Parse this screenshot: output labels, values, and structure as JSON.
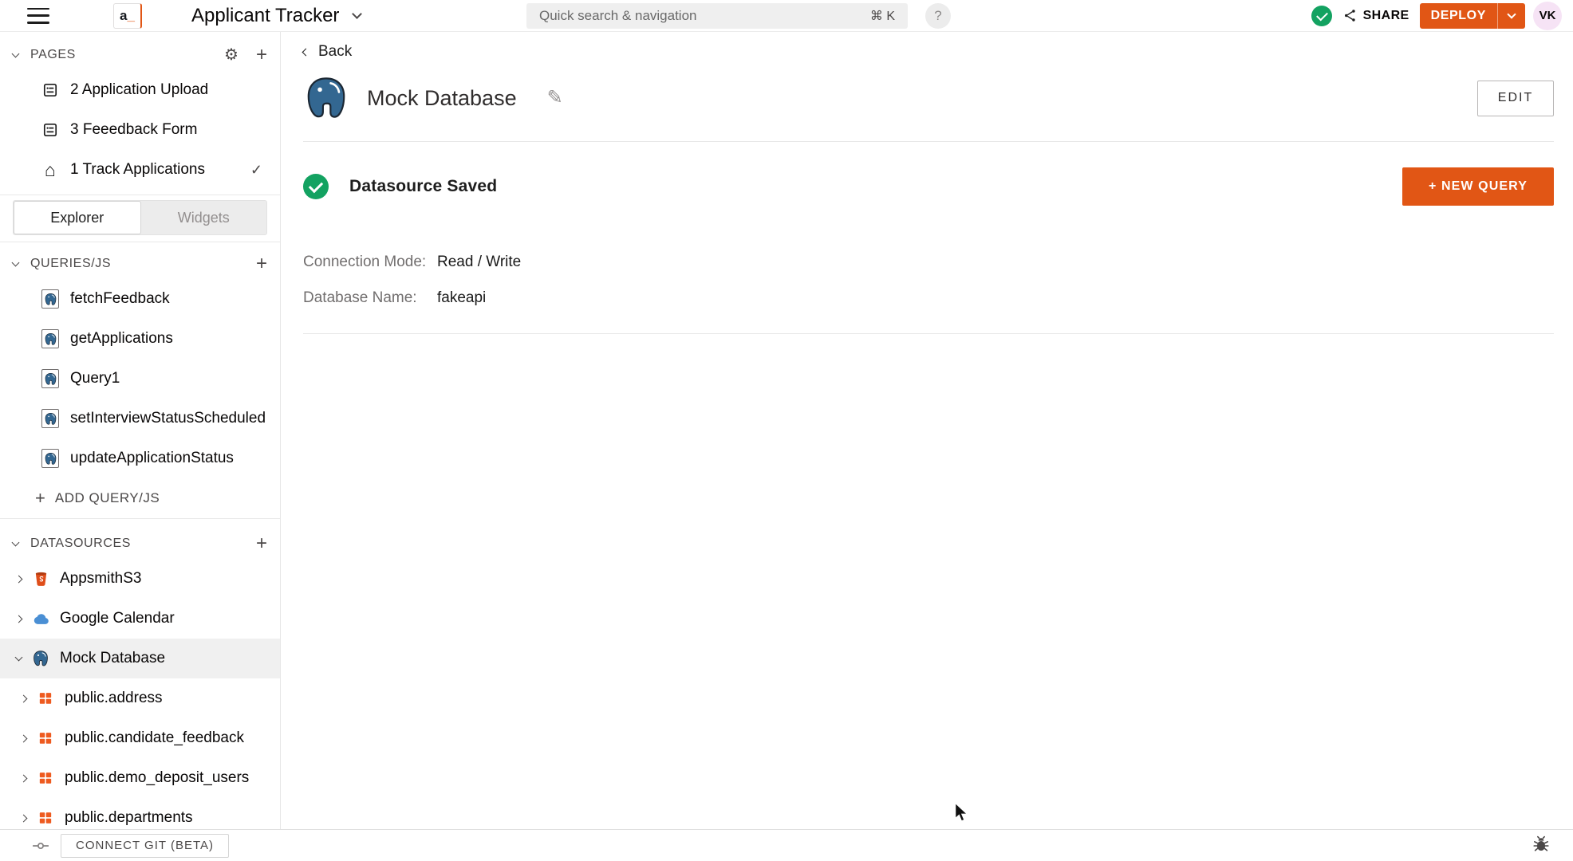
{
  "topbar": {
    "logo_a": "a",
    "logo_underscore": "_",
    "app_name": "Applicant Tracker",
    "search_placeholder": "Quick search & navigation",
    "search_shortcut": "⌘ K",
    "help_label": "?",
    "share_label": "SHARE",
    "deploy_label": "DEPLOY",
    "avatar_initials": "VK"
  },
  "sidebar": {
    "pages": {
      "header": "PAGES",
      "items": [
        {
          "label": "2 Application Upload"
        },
        {
          "label": "3 Feeedback Form"
        },
        {
          "label": "1 Track Applications"
        }
      ],
      "current_page_check": "✓"
    },
    "tabs": {
      "explorer": "Explorer",
      "widgets": "Widgets"
    },
    "queries": {
      "header": "QUERIES/JS",
      "items": [
        {
          "label": "fetchFeedback"
        },
        {
          "label": "getApplications"
        },
        {
          "label": "Query1"
        },
        {
          "label": "setInterviewStatusScheduled"
        },
        {
          "label": "updateApplicationStatus"
        }
      ],
      "add_plus": "+",
      "add_label": "ADD QUERY/JS"
    },
    "datasources": {
      "header": "DATASOURCES",
      "items": [
        {
          "label": "AppsmithS3"
        },
        {
          "label": "Google Calendar"
        },
        {
          "label": "Mock Database"
        }
      ],
      "tables": [
        {
          "label": "public.address"
        },
        {
          "label": "public.candidate_feedback"
        },
        {
          "label": "public.demo_deposit_users"
        },
        {
          "label": "public.departments"
        }
      ]
    },
    "icons": {
      "gear": "⚙",
      "plus": "+",
      "home": "⌂"
    }
  },
  "main": {
    "back_label": "Back",
    "title": "Mock Database",
    "rename_icon": "✎",
    "edit_button": "EDIT",
    "status_text": "Datasource Saved",
    "new_query_button": "+ NEW QUERY",
    "fields": [
      {
        "label": "Connection Mode:",
        "value": "Read / Write"
      },
      {
        "label": "Database Name:",
        "value": "fakeapi"
      }
    ]
  },
  "footer": {
    "connect_git_label": "CONNECT GIT (BETA)"
  },
  "colors": {
    "accent_orange": "#E15615",
    "success_green": "#13A261",
    "postgres_blue": "#336791",
    "table_icon_orange": "#EE5A1F",
    "s3_icon_orange": "#DF4E1A",
    "gcal_icon_blue": "#4A8FD4",
    "avatar_pink": "#F6E3F5"
  }
}
